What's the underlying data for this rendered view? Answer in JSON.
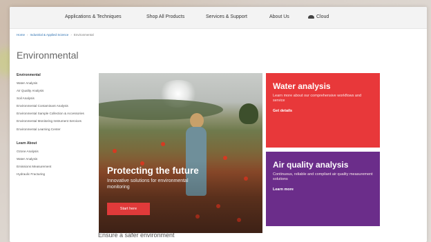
{
  "topnav": {
    "items": [
      "Applications & Techniques",
      "Shop All Products",
      "Services & Support",
      "About Us",
      "Cloud"
    ]
  },
  "breadcrumb": {
    "items": [
      "Home",
      "Industrial & Applied Science",
      "Environmental"
    ]
  },
  "page": {
    "title": "Environmental"
  },
  "sidebar": {
    "section1": {
      "heading": "Environmental",
      "items": [
        "Water Analysis",
        "Air Quality Analysis",
        "Soil Analysis",
        "Environmental Contaminant Analysis",
        "Environmental Sample Collection & Accessories",
        "Environmental Monitoring Instrument Services",
        "Environmental Learning Center"
      ]
    },
    "section2": {
      "heading": "Learn About",
      "items": [
        "Ozone Analysis",
        "Water Analysis",
        "Emissions Measurement",
        "Hydraulic Fracturing"
      ]
    }
  },
  "hero": {
    "title": "Protecting the future",
    "subtitle": "Innovative solutions for environmental monitoring",
    "button": "Start here"
  },
  "tiles": {
    "water": {
      "title": "Water analysis",
      "desc": "Learn more about our comprehensive workflows and service",
      "link": "Get details"
    },
    "air": {
      "title": "Air quality analysis",
      "desc": "Continuous, reliable and compliant air quality measurement solutions",
      "link": "Learn more"
    }
  },
  "bottom": {
    "heading": "Ensure a safer environment"
  },
  "colors": {
    "water_tile": "#e8383a",
    "air_tile": "#6b2d8a",
    "hero_button": "#e03a3a",
    "breadcrumb_link": "#2a6fb0"
  }
}
